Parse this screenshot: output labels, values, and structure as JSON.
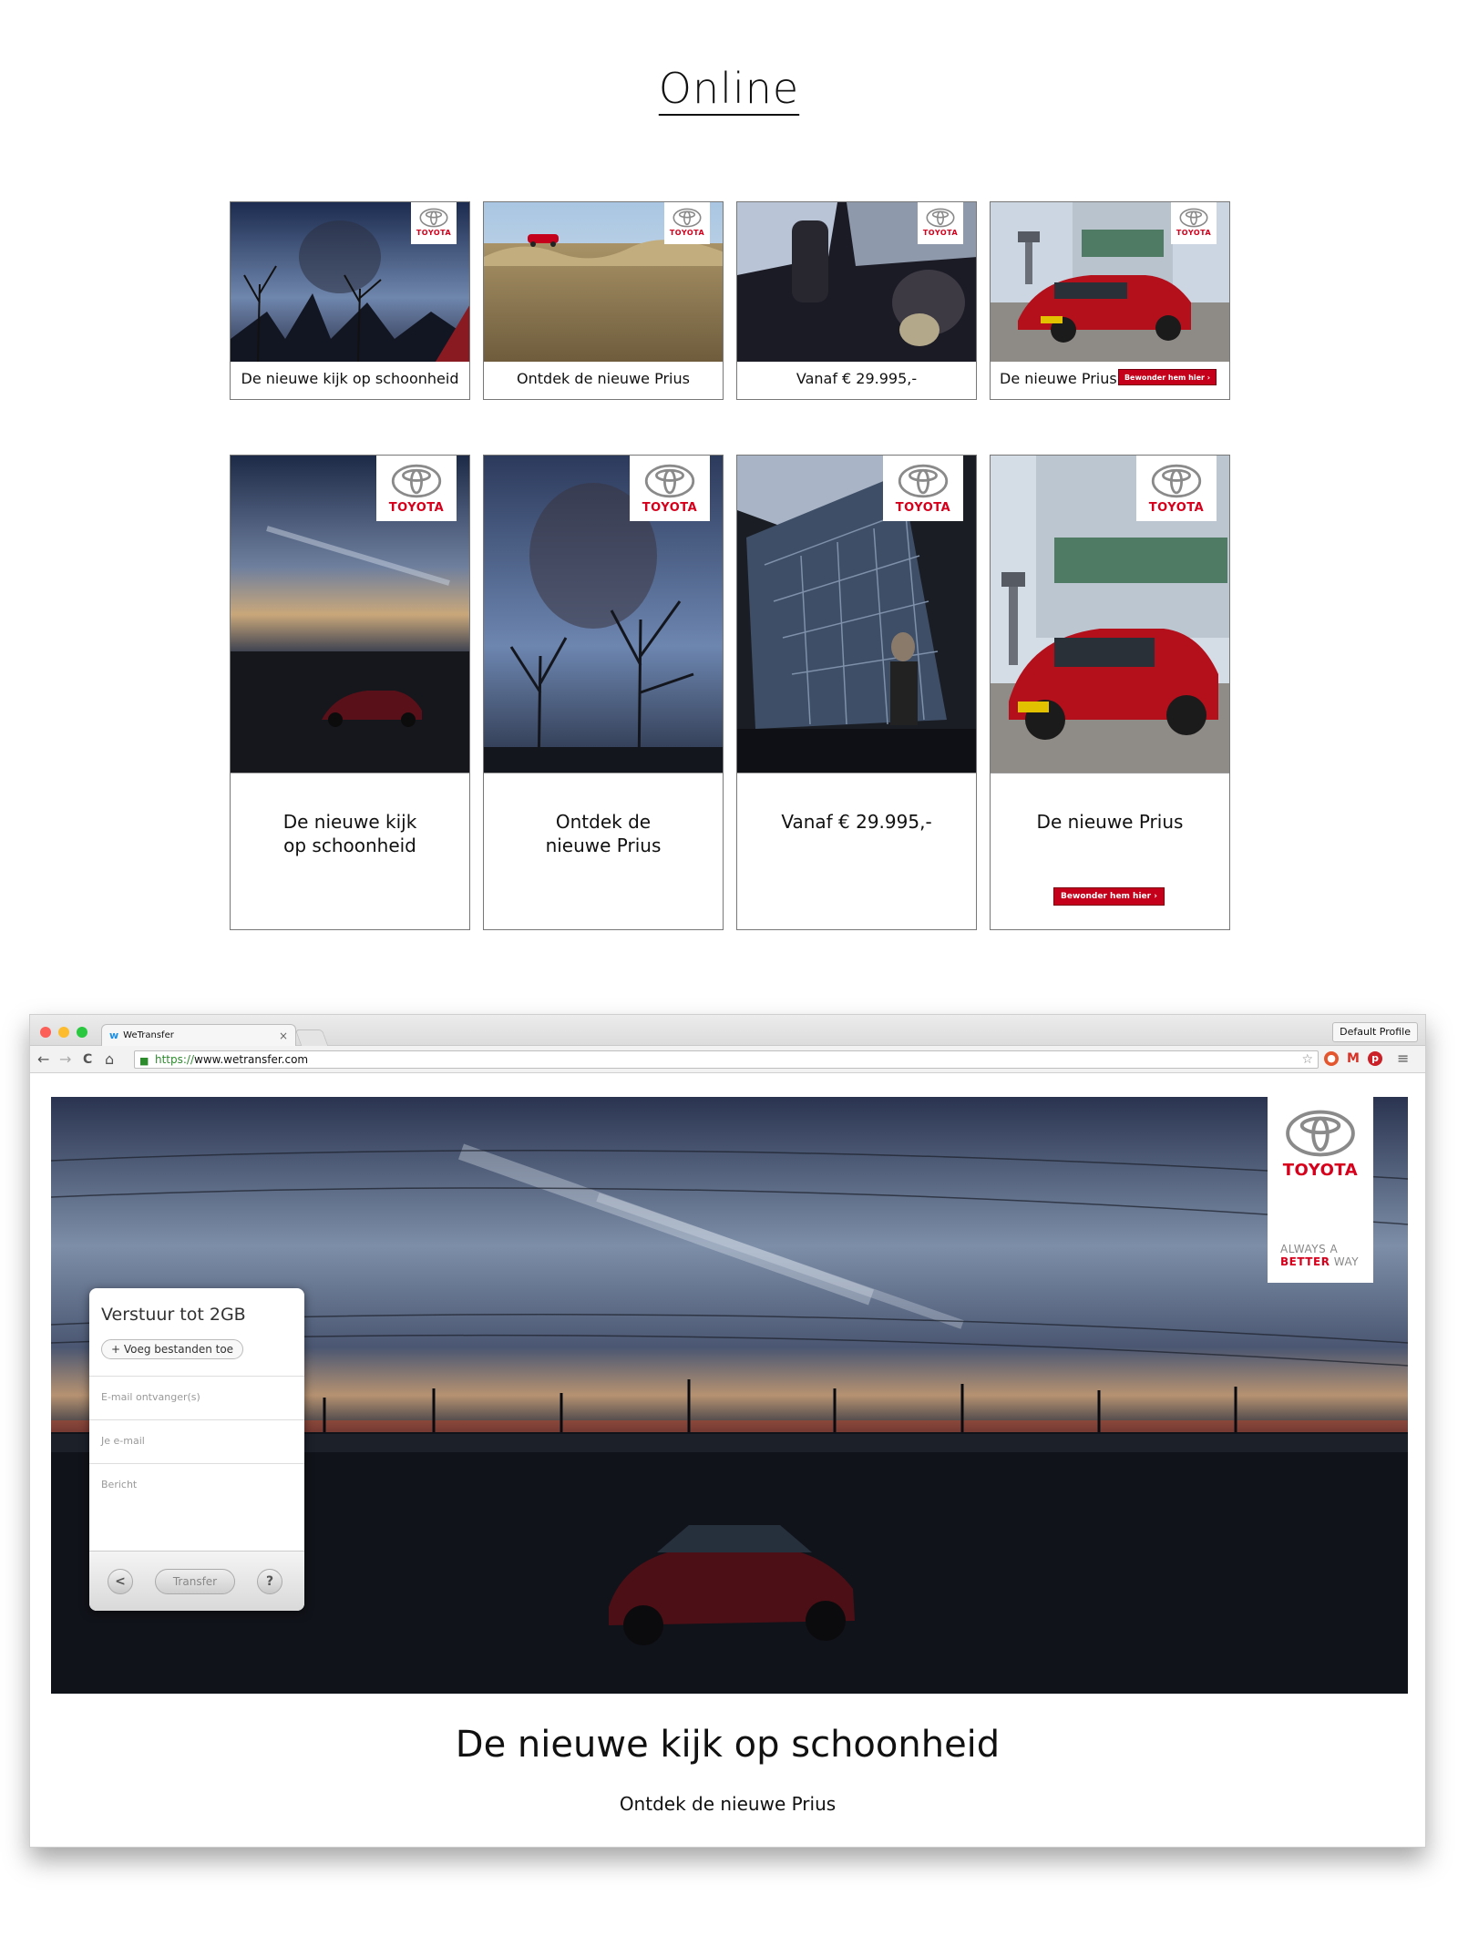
{
  "page": {
    "heading": "Online"
  },
  "logo": {
    "word": "TOYOTA"
  },
  "banners_row1": [
    {
      "caption": "De nieuwe kijk op schoonheid"
    },
    {
      "caption": "Ontdek de nieuwe Prius"
    },
    {
      "caption": "Vanaf € 29.995,-"
    },
    {
      "caption": "De nieuwe Prius",
      "cta": "Bewonder hem hier ›"
    }
  ],
  "banners_row2": [
    {
      "line1": "De nieuwe kijk",
      "line2": "op schoonheid"
    },
    {
      "line1": "Ontdek de",
      "line2": "nieuwe Prius"
    },
    {
      "line1": "Vanaf € 29.995,-",
      "line2": ""
    },
    {
      "line1": "De nieuwe Prius",
      "line2": "",
      "cta": "Bewonder hem hier ›"
    }
  ],
  "browser": {
    "tab_title": "WeTransfer",
    "tab_close": "×",
    "profile": "Default Profile",
    "url_scheme": "https://",
    "url_rest": "www.wetransfer.com",
    "nav": {
      "back": "←",
      "forward": "→",
      "reload": "C",
      "home": "⌂"
    },
    "menu": "≡"
  },
  "hero": {
    "tagline_1": "ALWAYS A",
    "tagline_2a": "BETTER",
    "tagline_2b": " WAY"
  },
  "wetransfer": {
    "title": "Verstuur tot 2GB",
    "add_files": "+ Voeg bestanden toe",
    "email_to_placeholder": "E-mail ontvanger(s)",
    "email_from_placeholder": "Je e-mail",
    "message_placeholder": "Bericht",
    "transfer_button": "Transfer",
    "help": "?"
  },
  "footer": {
    "headline": "De nieuwe kijk op schoonheid",
    "subline": "Ontdek de nieuwe Prius"
  }
}
